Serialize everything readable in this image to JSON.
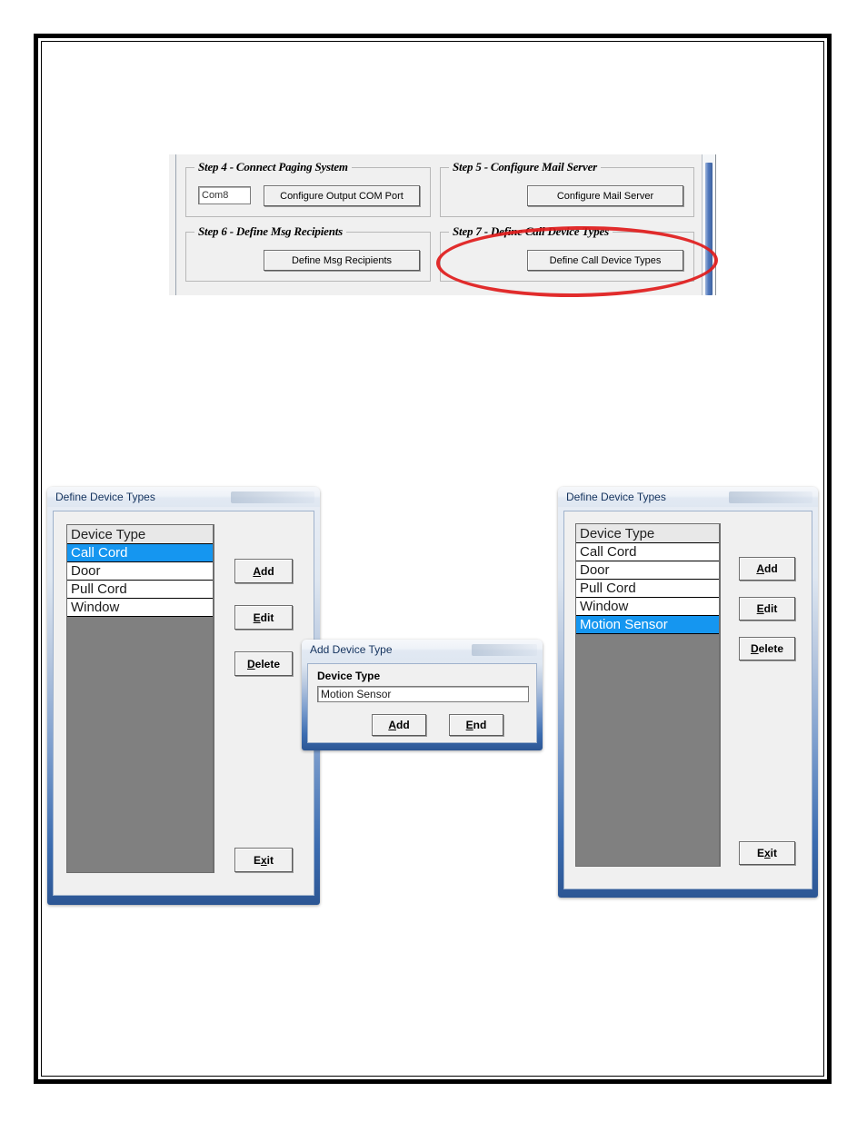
{
  "steps_panel": {
    "groups": [
      {
        "title": "Step 4 - Connect Paging System",
        "com_port_value": "Com8",
        "button_label": "Configure Output COM Port"
      },
      {
        "title": "Step 5 - Configure Mail Server",
        "button_label": "Configure Mail Server"
      },
      {
        "title": "Step 6 - Define Msg Recipients",
        "button_label": "Define Msg Recipients"
      },
      {
        "title": "Step 7 - Define Call Device Types",
        "button_label": "Define Call Device Types"
      }
    ],
    "highlight_color": "#e01b1b"
  },
  "define_dialog_before": {
    "title": "Define Device Types",
    "grid": {
      "header": "Device Type",
      "rows": [
        {
          "label": "Call Cord",
          "selected": true
        },
        {
          "label": "Door",
          "selected": false
        },
        {
          "label": "Pull Cord",
          "selected": false
        },
        {
          "label": "Window",
          "selected": false
        }
      ]
    },
    "buttons": {
      "add": "Add",
      "add_accel": "A",
      "edit": "Edit",
      "edit_accel": "E",
      "delete": "Delete",
      "delete_accel": "D",
      "exit": "Exit",
      "exit_accel": "x"
    }
  },
  "add_dialog": {
    "title": "Add Device Type",
    "field_label": "Device Type",
    "field_value": "Motion Sensor",
    "buttons": {
      "add": "Add",
      "add_accel": "A",
      "end": "End",
      "end_accel": "E"
    }
  },
  "define_dialog_after": {
    "title": "Define Device Types",
    "grid": {
      "header": "Device Type",
      "rows": [
        {
          "label": "Call Cord",
          "selected": false
        },
        {
          "label": "Door",
          "selected": false
        },
        {
          "label": "Pull Cord",
          "selected": false
        },
        {
          "label": "Window",
          "selected": false
        },
        {
          "label": "Motion Sensor",
          "selected": true
        }
      ]
    },
    "buttons": {
      "add": "Add",
      "add_accel": "A",
      "edit": "Edit",
      "edit_accel": "E",
      "delete": "Delete",
      "delete_accel": "D",
      "exit": "Exit",
      "exit_accel": "x"
    }
  },
  "colors": {
    "selection_blue": "#1596f0",
    "dialog_frame_blue": "#2c5694",
    "panel_gray": "#f0f0f0",
    "grid_empty_gray": "#808080"
  }
}
